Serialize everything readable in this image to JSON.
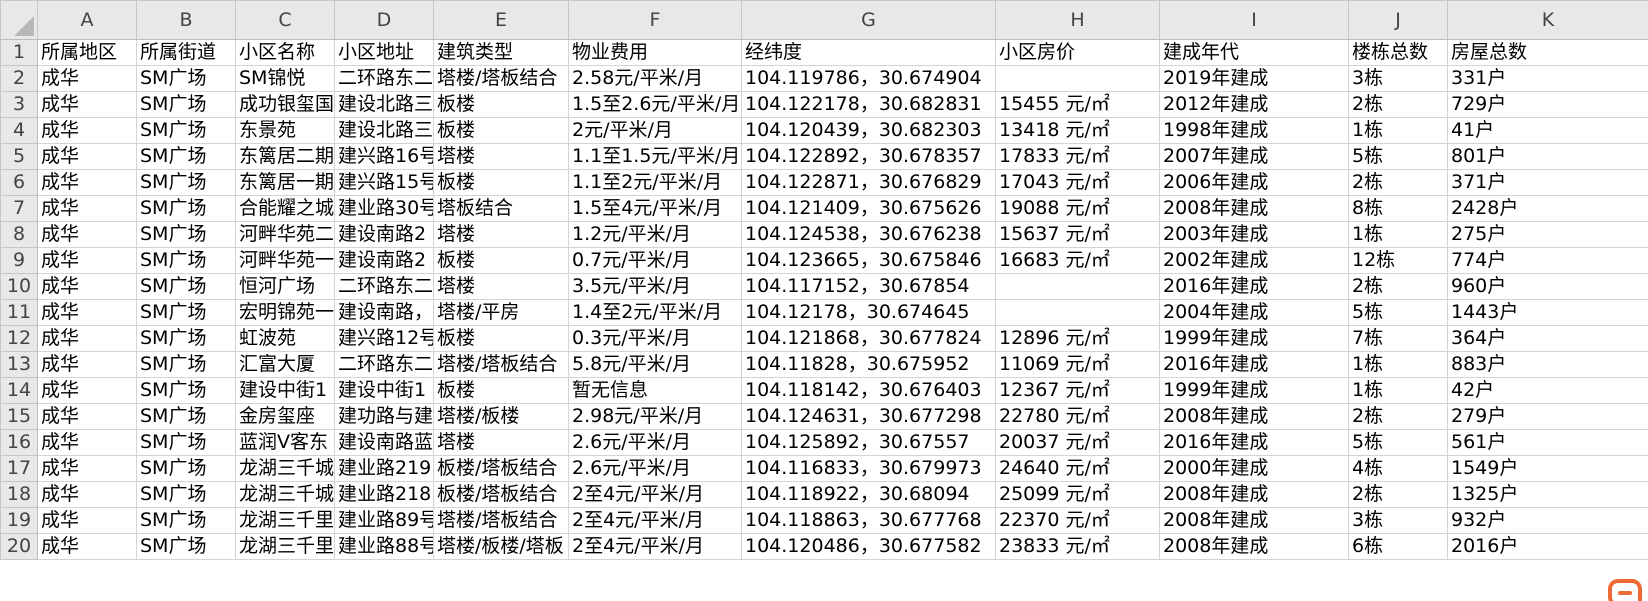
{
  "columns": [
    {
      "letter": "A"
    },
    {
      "letter": "B"
    },
    {
      "letter": "C"
    },
    {
      "letter": "D"
    },
    {
      "letter": "E"
    },
    {
      "letter": "F"
    },
    {
      "letter": "G"
    },
    {
      "letter": "H"
    },
    {
      "letter": "I"
    },
    {
      "letter": "J"
    },
    {
      "letter": "K"
    }
  ],
  "rows": [
    {
      "num": "1",
      "cells": [
        "所属地区",
        "所属街道",
        "小区名称",
        "小区地址",
        "建筑类型",
        "物业费用",
        "经纬度",
        "小区房价",
        "建成年代",
        "楼栋总数",
        "房屋总数"
      ]
    },
    {
      "num": "2",
      "cells": [
        "成华",
        "SM广场",
        "SM锦悦",
        "二环路东二",
        "塔楼/塔板结合",
        "2.58元/平米/月",
        "104.119786，30.674904",
        "",
        "2019年建成",
        "3栋",
        "331户"
      ]
    },
    {
      "num": "3",
      "cells": [
        "成华",
        "SM广场",
        "成功银玺国",
        "建设北路三",
        "板楼",
        "1.5至2.6元/平米/月",
        "104.122178，30.682831",
        "15455 元/㎡",
        "2012年建成",
        "2栋",
        "729户"
      ]
    },
    {
      "num": "4",
      "cells": [
        "成华",
        "SM广场",
        "东景苑",
        "建设北路三",
        "板楼",
        "2元/平米/月",
        "104.120439，30.682303",
        "13418 元/㎡",
        "1998年建成",
        "1栋",
        "41户"
      ]
    },
    {
      "num": "5",
      "cells": [
        "成华",
        "SM广场",
        "东篱居二期",
        "建兴路16号",
        "塔楼",
        "1.1至1.5元/平米/月",
        "104.122892，30.678357",
        "17833 元/㎡",
        "2007年建成",
        "5栋",
        "801户"
      ]
    },
    {
      "num": "6",
      "cells": [
        "成华",
        "SM广场",
        "东篱居一期",
        "建兴路15号",
        "板楼",
        "1.1至2元/平米/月",
        "104.122871，30.676829",
        "17043 元/㎡",
        "2006年建成",
        "2栋",
        "371户"
      ]
    },
    {
      "num": "7",
      "cells": [
        "成华",
        "SM广场",
        "合能耀之城",
        "建业路30号",
        "塔板结合",
        "1.5至4元/平米/月",
        "104.121409，30.675626",
        "19088 元/㎡",
        "2008年建成",
        "8栋",
        "2428户"
      ]
    },
    {
      "num": "8",
      "cells": [
        "成华",
        "SM广场",
        "河畔华苑二",
        "建设南路2",
        "塔楼",
        "1.2元/平米/月",
        "104.124538，30.676238",
        "15637 元/㎡",
        "2003年建成",
        "1栋",
        "275户"
      ]
    },
    {
      "num": "9",
      "cells": [
        "成华",
        "SM广场",
        "河畔华苑一",
        "建设南路2",
        "板楼",
        "0.7元/平米/月",
        "104.123665，30.675846",
        "16683 元/㎡",
        "2002年建成",
        "12栋",
        "774户"
      ]
    },
    {
      "num": "10",
      "cells": [
        "成华",
        "SM广场",
        "恒河广场",
        "二环路东二",
        "塔楼",
        "3.5元/平米/月",
        "104.117152，30.67854",
        "",
        "2016年建成",
        "2栋",
        "960户"
      ]
    },
    {
      "num": "11",
      "cells": [
        "成华",
        "SM广场",
        "宏明锦苑一",
        "建设南路，",
        "塔楼/平房",
        "1.4至2元/平米/月",
        "104.12178，30.674645",
        "",
        "2004年建成",
        "5栋",
        "1443户"
      ]
    },
    {
      "num": "12",
      "cells": [
        "成华",
        "SM广场",
        "虹波苑",
        "建兴路12号",
        "板楼",
        "0.3元/平米/月",
        "104.121868，30.677824",
        "12896 元/㎡",
        "1999年建成",
        "7栋",
        "364户"
      ]
    },
    {
      "num": "13",
      "cells": [
        "成华",
        "SM广场",
        "汇富大厦",
        "二环路东二",
        "塔楼/塔板结合",
        "5.8元/平米/月",
        "104.11828，30.675952",
        "11069 元/㎡",
        "2016年建成",
        "1栋",
        "883户"
      ]
    },
    {
      "num": "14",
      "cells": [
        "成华",
        "SM广场",
        "建设中街1",
        "建设中街1",
        "板楼",
        "暂无信息",
        "104.118142，30.676403",
        "12367 元/㎡",
        "1999年建成",
        "1栋",
        "42户"
      ]
    },
    {
      "num": "15",
      "cells": [
        "成华",
        "SM广场",
        "金房玺座",
        "建功路与建",
        "塔楼/板楼",
        "2.98元/平米/月",
        "104.124631，30.677298",
        "22780 元/㎡",
        "2008年建成",
        "2栋",
        "279户"
      ]
    },
    {
      "num": "16",
      "cells": [
        "成华",
        "SM广场",
        "蓝润V客东",
        "建设南路蓝",
        "塔楼",
        "2.6元/平米/月",
        "104.125892，30.67557",
        "20037 元/㎡",
        "2016年建成",
        "5栋",
        "561户"
      ]
    },
    {
      "num": "17",
      "cells": [
        "成华",
        "SM广场",
        "龙湖三千城",
        "建业路219",
        "板楼/塔板结合",
        "2.6元/平米/月",
        "104.116833，30.679973",
        "24640 元/㎡",
        "2000年建成",
        "4栋",
        "1549户"
      ]
    },
    {
      "num": "18",
      "cells": [
        "成华",
        "SM广场",
        "龙湖三千城",
        "建业路218",
        "板楼/塔板结合",
        "2至4元/平米/月",
        "104.118922，30.68094",
        "25099 元/㎡",
        "2008年建成",
        "2栋",
        "1325户"
      ]
    },
    {
      "num": "19",
      "cells": [
        "成华",
        "SM广场",
        "龙湖三千里",
        "建业路89号",
        "塔楼/塔板结合",
        "2至4元/平米/月",
        "104.118863，30.677768",
        "22370 元/㎡",
        "2008年建成",
        "3栋",
        "932户"
      ]
    },
    {
      "num": "20",
      "cells": [
        "成华",
        "SM广场",
        "龙湖三千里",
        "建业路88号",
        "塔楼/板楼/塔板",
        "2至4元/平米/月",
        "104.120486，30.677582",
        "23833 元/㎡",
        "2008年建成",
        "6栋",
        "2016户"
      ]
    }
  ],
  "colors": {
    "header_bg": "#e8e8e8",
    "gridline": "#d4d4d4",
    "overlay_accent": "#ef6b35"
  },
  "icons": {
    "select_all": "select-all-triangle-icon",
    "overlay": "floating-app-icon"
  }
}
